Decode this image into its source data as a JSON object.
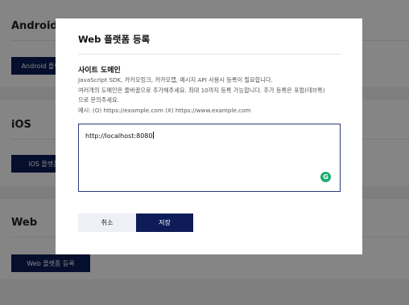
{
  "background": {
    "sections": [
      {
        "title": "Android",
        "button_label": "Android 플랫폼 등록"
      },
      {
        "title": "iOS",
        "button_label": "iOS 플랫폼 등록"
      },
      {
        "title": "Web",
        "button_label": "Web 플랫폼 등록"
      }
    ]
  },
  "modal": {
    "title": "Web 플랫폼 등록",
    "section_label": "사이트 도메인",
    "help_lines": [
      "JavaScript SDK, 카카오링크, 카카오맵, 메시지 API 사용시 등록이 필요합니다.",
      "여러개의 도메인은 줄바꿈으로 추가해주세요. 최대 10까지 등록 가능합니다. 추가 등록은 포럼(데브톡)",
      "으로 문의주세요.",
      "예시: (O) https://example.com (X) https://www.example.com"
    ],
    "domain_value": "http://localhost:8080",
    "grammar_icon_glyph": "G",
    "cancel_label": "취소",
    "save_label": "저장"
  },
  "colors": {
    "primary": "#0d1c57",
    "textarea_border": "#2d3a78",
    "grammar_icon": "#1fae72",
    "cancel_bg": "#eef0f5"
  }
}
